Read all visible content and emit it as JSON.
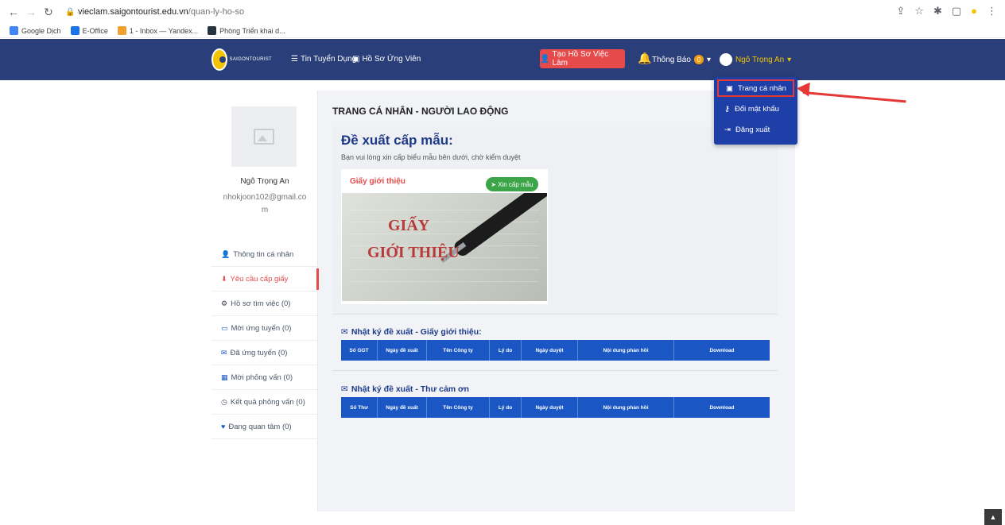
{
  "browser": {
    "url_host": "vieclam.saigontourist.edu.vn",
    "url_path": "/quan-ly-ho-so",
    "bookmarks": [
      "Google Dịch",
      "E-Office",
      "1 - Inbox — Yandex...",
      "Phòng Triển khai d..."
    ]
  },
  "navbar": {
    "logo_text": "SAIGONTOURIST",
    "link_jobs": "Tin Tuyển Dụng",
    "link_profiles": "Hồ Sơ Ứng Viên",
    "create_button": "Tạo Hồ Sơ Việc Làm",
    "notifications": "Thông Báo",
    "notification_count": "0",
    "user_name": "Ngô Trọng An"
  },
  "dropdown": {
    "items": [
      "Trang cá nhân",
      "Đổi mật khẩu",
      "Đăng xuất"
    ]
  },
  "sidebar": {
    "name": "Ngô Trọng An",
    "email": "nhokjoon102@gmail.com",
    "items": [
      "Thông tin cá nhân",
      "Yêu cầu cấp giấy",
      "Hồ sơ tìm việc (0)",
      "Mời ứng tuyển (0)",
      "Đã ứng tuyển (0)",
      "Mời phỏng vấn (0)",
      "Kết quả phỏng vấn (0)",
      "Đang quan tâm (0)"
    ]
  },
  "main": {
    "page_title": "TRANG CÁ NHÂN - NGƯỜI LAO ĐỘNG",
    "suggest_heading": "Đề xuất cấp mẫu:",
    "suggest_sub": "Bạn vui lòng xin cấp biểu mẫu bên dưới, chờ kiểm duyệt",
    "doc_title": "Giấy giới thiệu",
    "request_button": "Xin cấp mẫu",
    "doc_image_line1": "GIẤY",
    "doc_image_line2": "GIỚI THIỆU",
    "log1_title": "Nhật ký đề xuất - Giấy giới thiệu:",
    "log1_headers": [
      "Số GGT",
      "Ngày đề xuất",
      "Tên Công ty",
      "Lý do",
      "Ngày duyệt",
      "Nội dung phản hồi",
      "Download"
    ],
    "log2_title": "Nhật ký đề xuất - Thư cảm ơn",
    "log2_headers": [
      "Số Thư",
      "Ngày đề xuất",
      "Tên Công ty",
      "Lý do",
      "Ngày duyệt",
      "Nội dung phản hồi",
      "Download"
    ]
  },
  "colors": {
    "navbar": "#2a3f7a",
    "create_button": "#e74a4a",
    "table_header": "#1a57c4",
    "dropdown": "#1f3fa8",
    "highlight": "#e53935"
  }
}
